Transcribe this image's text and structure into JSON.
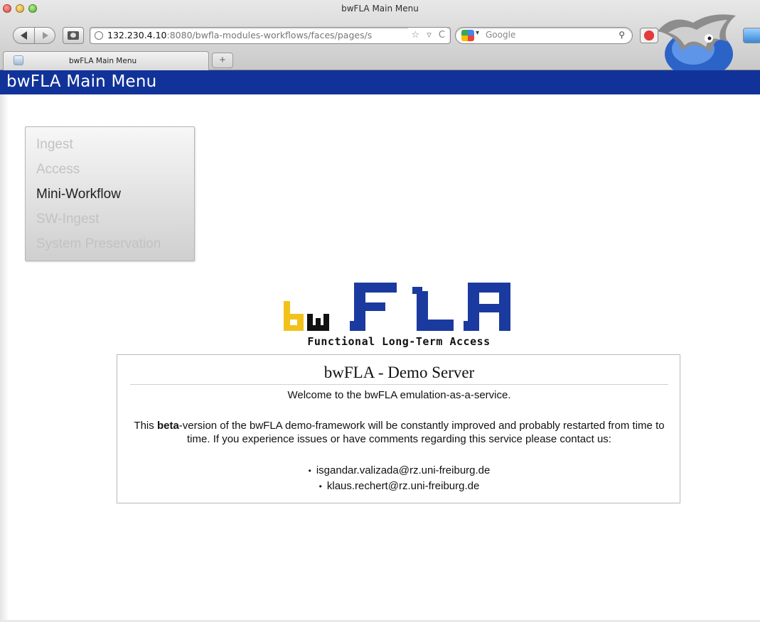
{
  "window": {
    "title": "bwFLA Main Menu"
  },
  "browser": {
    "url_host": "132.230.4.10",
    "url_rest": ":8080/bwfla-modules-workflows/faces/pages/s",
    "url_icons": "☆ ▿ C",
    "search_placeholder": "Google",
    "search_icon": "magnifier-icon",
    "tab_label": "bwFLA Main Menu",
    "new_tab_label": "+"
  },
  "header": {
    "title": "bwFLA Main Menu",
    "background": "#113399"
  },
  "menu": {
    "items": [
      {
        "label": "Ingest",
        "enabled": false
      },
      {
        "label": "Access",
        "enabled": false
      },
      {
        "label": "Mini-Workflow",
        "enabled": true
      },
      {
        "label": "SW-Ingest",
        "enabled": false
      },
      {
        "label": "System Preservation",
        "enabled": false
      }
    ]
  },
  "logo": {
    "text": "Functional Long-Term Access",
    "colors": {
      "b": "#f2c21b",
      "w": "#111111",
      "fla": "#1a3aa0"
    }
  },
  "info": {
    "title": "bwFLA - Demo Server",
    "welcome": "Welcome to the bwFLA emulation-as-a-service.",
    "notice_pre": "This ",
    "notice_bold": "beta",
    "notice_post": "-version of the bwFLA demo-framework will be constantly improved and probably restarted from time to time. If you experience issues or have comments regarding this service please contact us:",
    "contacts": [
      "isgandar.valizada@rz.uni-freiburg.de",
      "klaus.rechert@rz.uni-freiburg.de"
    ]
  }
}
